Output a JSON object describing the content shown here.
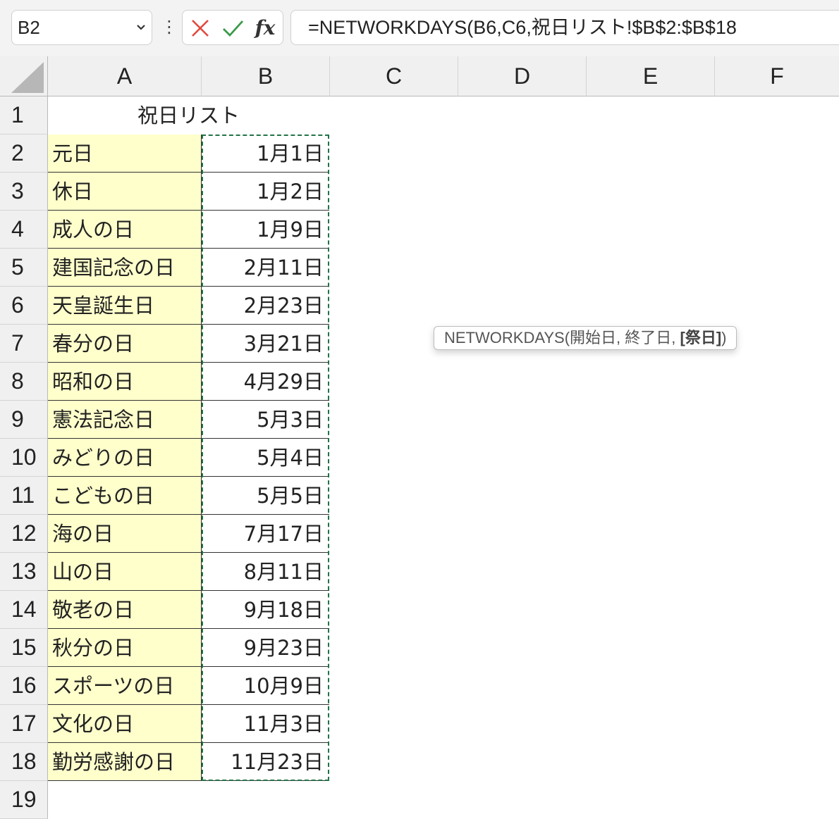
{
  "formula_bar": {
    "name_box": "B2",
    "formula": "=NETWORKDAYS(B6,C6,祝日リスト!$B$2:$B$18",
    "fx_label": "fx"
  },
  "columns": [
    "A",
    "B",
    "C",
    "D",
    "E",
    "F"
  ],
  "title": "祝日リスト",
  "rows": [
    {
      "num": "1"
    },
    {
      "num": "2",
      "name": "元日",
      "date": "1月1日"
    },
    {
      "num": "3",
      "name": "休日",
      "date": "1月2日"
    },
    {
      "num": "4",
      "name": "成人の日",
      "date": "1月9日"
    },
    {
      "num": "5",
      "name": "建国記念の日",
      "date": "2月11日"
    },
    {
      "num": "6",
      "name": "天皇誕生日",
      "date": "2月23日"
    },
    {
      "num": "7",
      "name": "春分の日",
      "date": "3月21日"
    },
    {
      "num": "8",
      "name": "昭和の日",
      "date": "4月29日"
    },
    {
      "num": "9",
      "name": "憲法記念日",
      "date": "5月3日"
    },
    {
      "num": "10",
      "name": "みどりの日",
      "date": "5月4日"
    },
    {
      "num": "11",
      "name": "こどもの日",
      "date": "5月5日"
    },
    {
      "num": "12",
      "name": "海の日",
      "date": "7月17日"
    },
    {
      "num": "13",
      "name": "山の日",
      "date": "8月11日"
    },
    {
      "num": "14",
      "name": "敬老の日",
      "date": "9月18日"
    },
    {
      "num": "15",
      "name": "秋分の日",
      "date": "9月23日"
    },
    {
      "num": "16",
      "name": "スポーツの日",
      "date": "10月9日"
    },
    {
      "num": "17",
      "name": "文化の日",
      "date": "11月3日"
    },
    {
      "num": "18",
      "name": "勤労感謝の日",
      "date": "11月23日"
    },
    {
      "num": "19"
    }
  ],
  "tooltip": {
    "prefix": "NETWORKDAYS(開始日, 終了日, ",
    "active_arg": "[祭日]",
    "suffix": ")"
  },
  "colors": {
    "holiday_fill": "#ffffcc",
    "copy_marquee": "#217346",
    "cancel_icon": "#e2483d",
    "enter_icon": "#3a9a48"
  }
}
